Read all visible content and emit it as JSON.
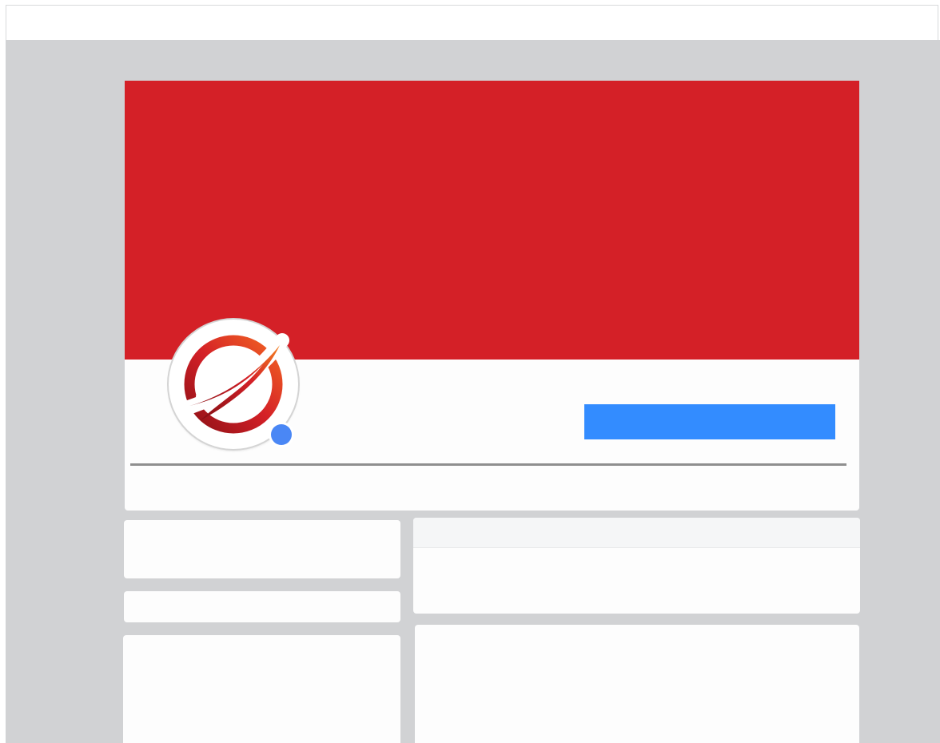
{
  "colors": {
    "cover": "#d42027",
    "primary_button": "#338cff",
    "online_indicator": "#4a87f5",
    "page_background": "#d1d2d4",
    "card_background": "#fdfdfd"
  },
  "profile": {
    "avatar_icon": "brand-logo-icon",
    "online_icon": "online-status-icon",
    "primary_button_label": ""
  }
}
